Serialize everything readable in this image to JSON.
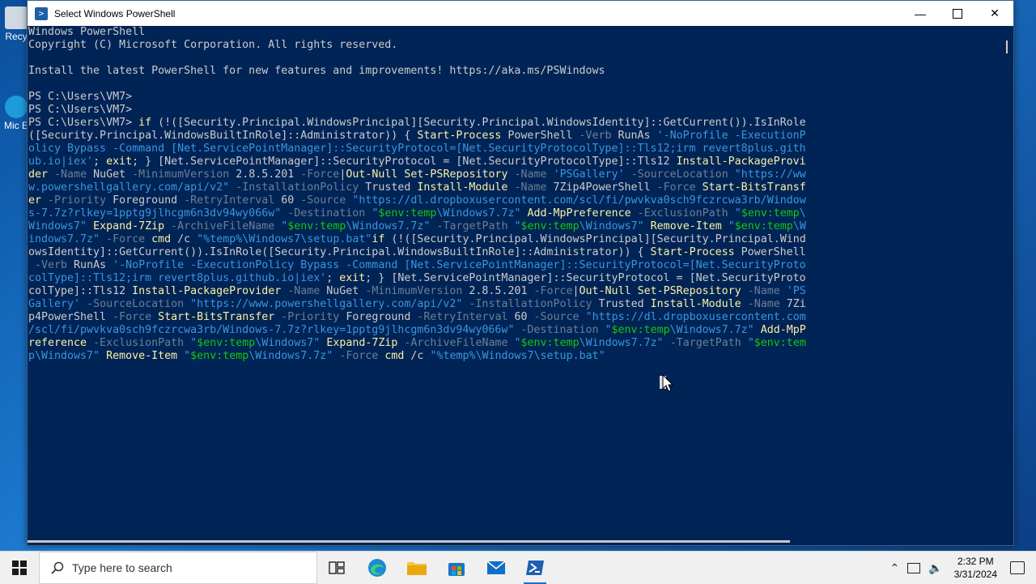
{
  "window": {
    "title": "Select Windows PowerShell",
    "minimize_icon": "minimize-icon",
    "maximize_icon": "maximize-icon",
    "close_icon": "close-icon"
  },
  "desktop": {
    "icons": [
      {
        "label": "Recy",
        "icon": "recycle-bin-icon"
      },
      {
        "label": "Mic E",
        "icon": "edge-icon"
      }
    ]
  },
  "console": {
    "lines": [
      [
        [
          "w",
          "Windows PowerShell"
        ]
      ],
      [
        [
          "w",
          "Copyright (C) Microsoft Corporation. All rights reserved."
        ]
      ],
      [
        [
          "w",
          ""
        ]
      ],
      [
        [
          "w",
          "Install the latest PowerShell for new features and improvements! https://aka.ms/PSWindows"
        ]
      ],
      [
        [
          "w",
          ""
        ]
      ],
      [
        [
          "w",
          "PS C:\\Users\\VM7>"
        ]
      ],
      [
        [
          "w",
          "PS C:\\Users\\VM7>"
        ]
      ],
      [
        [
          "w",
          "PS C:\\Users\\VM7> "
        ],
        [
          "y",
          "if"
        ],
        [
          "w",
          " (!([Security.Principal.WindowsPrincipal][Security.Principal.WindowsIdentity]::GetCurrent()).IsInRole"
        ]
      ],
      [
        [
          "w",
          "([Security.Principal.WindowsBuiltInRole]::Administrator)) { "
        ],
        [
          "y",
          "Start-Process"
        ],
        [
          "w",
          " PowerShell "
        ],
        [
          "g",
          "-Verb"
        ],
        [
          "w",
          " RunAs "
        ],
        [
          "c",
          "'-NoProfile -ExecutionP"
        ]
      ],
      [
        [
          "c",
          "olicy Bypass -Command [Net.ServicePointManager]::SecurityProtocol=[Net.SecurityProtocolType]::Tls12;irm revert8plus.gith"
        ]
      ],
      [
        [
          "c",
          "ub.io|iex'"
        ],
        [
          "w",
          "; "
        ],
        [
          "y",
          "exit"
        ],
        [
          "w",
          "; } [Net.ServicePointManager]::SecurityProtocol = [Net.SecurityProtocolType]::Tls12 "
        ],
        [
          "y",
          "Install-PackageProvi"
        ]
      ],
      [
        [
          "y",
          "der"
        ],
        [
          "w",
          " "
        ],
        [
          "g",
          "-Name"
        ],
        [
          "w",
          " NuGet "
        ],
        [
          "g",
          "-MinimumVersion"
        ],
        [
          "w",
          " 2.8.5.201 "
        ],
        [
          "g",
          "-Force"
        ],
        [
          "w",
          "|"
        ],
        [
          "y",
          "Out-Null"
        ],
        [
          "w",
          " "
        ],
        [
          "y",
          "Set-PSRepository"
        ],
        [
          "w",
          " "
        ],
        [
          "g",
          "-Name"
        ],
        [
          "w",
          " "
        ],
        [
          "c",
          "'PSGallery'"
        ],
        [
          "w",
          " "
        ],
        [
          "g",
          "-SourceLocation"
        ],
        [
          "w",
          " "
        ],
        [
          "c",
          "\"https://ww"
        ]
      ],
      [
        [
          "c",
          "w.powershellgallery.com/api/v2\""
        ],
        [
          "w",
          " "
        ],
        [
          "g",
          "-InstallationPolicy"
        ],
        [
          "w",
          " Trusted "
        ],
        [
          "y",
          "Install-Module"
        ],
        [
          "w",
          " "
        ],
        [
          "g",
          "-Name"
        ],
        [
          "w",
          " 7Zip4PowerShell "
        ],
        [
          "g",
          "-Force"
        ],
        [
          "w",
          " "
        ],
        [
          "y",
          "Start-BitsTransf"
        ]
      ],
      [
        [
          "y",
          "er"
        ],
        [
          "w",
          " "
        ],
        [
          "g",
          "-Priority"
        ],
        [
          "w",
          " Foreground "
        ],
        [
          "g",
          "-RetryInterval"
        ],
        [
          "w",
          " 60 "
        ],
        [
          "g",
          "-Source"
        ],
        [
          "w",
          " "
        ],
        [
          "c",
          "\"https://dl.dropboxusercontent.com/scl/fi/pwvkva0sch9fczrcwa3rb/Window"
        ]
      ],
      [
        [
          "c",
          "s-7.7z?rlkey=1pptg9jlhcgm6n3dv94wy066w\""
        ],
        [
          "w",
          " "
        ],
        [
          "g",
          "-Destination"
        ],
        [
          "w",
          " "
        ],
        [
          "c",
          "\""
        ],
        [
          "v",
          "$env:temp"
        ],
        [
          "c",
          "\\Windows7.7z\""
        ],
        [
          "w",
          " "
        ],
        [
          "y",
          "Add-MpPreference"
        ],
        [
          "w",
          " "
        ],
        [
          "g",
          "-ExclusionPath"
        ],
        [
          "w",
          " "
        ],
        [
          "c",
          "\""
        ],
        [
          "v",
          "$env:temp"
        ],
        [
          "c",
          "\\"
        ]
      ],
      [
        [
          "c",
          "Windows7\""
        ],
        [
          "w",
          " "
        ],
        [
          "y",
          "Expand-7Zip"
        ],
        [
          "w",
          " "
        ],
        [
          "g",
          "-ArchiveFileName"
        ],
        [
          "w",
          " "
        ],
        [
          "c",
          "\""
        ],
        [
          "v",
          "$env:temp"
        ],
        [
          "c",
          "\\Windows7.7z\""
        ],
        [
          "w",
          " "
        ],
        [
          "g",
          "-TargetPath"
        ],
        [
          "w",
          " "
        ],
        [
          "c",
          "\""
        ],
        [
          "v",
          "$env:temp"
        ],
        [
          "c",
          "\\Windows7\""
        ],
        [
          "w",
          " "
        ],
        [
          "y",
          "Remove-Item"
        ],
        [
          "w",
          " "
        ],
        [
          "c",
          "\""
        ],
        [
          "v",
          "$env:temp"
        ],
        [
          "c",
          "\\W"
        ]
      ],
      [
        [
          "c",
          "indows7.7z\""
        ],
        [
          "w",
          " "
        ],
        [
          "g",
          "-Force"
        ],
        [
          "w",
          " "
        ],
        [
          "y",
          "cmd"
        ],
        [
          "w",
          " /c "
        ],
        [
          "c",
          "\"%temp%\\Windows7\\setup.bat\""
        ],
        [
          "y",
          "if"
        ],
        [
          "w",
          " (!([Security.Principal.WindowsPrincipal][Security.Principal.Wind"
        ]
      ],
      [
        [
          "w",
          "owsIdentity]::GetCurrent()).IsInRole([Security.Principal.WindowsBuiltInRole]::Administrator)) { "
        ],
        [
          "y",
          "Start-Process"
        ],
        [
          "w",
          " PowerShell"
        ]
      ],
      [
        [
          "w",
          " "
        ],
        [
          "g",
          "-Verb"
        ],
        [
          "w",
          " RunAs "
        ],
        [
          "c",
          "'-NoProfile -ExecutionPolicy Bypass -Command [Net.ServicePointManager]::SecurityProtocol=[Net.SecurityProto"
        ]
      ],
      [
        [
          "c",
          "colType]::Tls12;irm revert8plus.github.io|iex'"
        ],
        [
          "w",
          "; "
        ],
        [
          "y",
          "exit"
        ],
        [
          "w",
          "; } [Net.ServicePointManager]::SecurityProtocol = [Net.SecurityProto"
        ]
      ],
      [
        [
          "w",
          "colType]::Tls12 "
        ],
        [
          "y",
          "Install-PackageProvider"
        ],
        [
          "w",
          " "
        ],
        [
          "g",
          "-Name"
        ],
        [
          "w",
          " NuGet "
        ],
        [
          "g",
          "-MinimumVersion"
        ],
        [
          "w",
          " 2.8.5.201 "
        ],
        [
          "g",
          "-Force"
        ],
        [
          "w",
          "|"
        ],
        [
          "y",
          "Out-Null"
        ],
        [
          "w",
          " "
        ],
        [
          "y",
          "Set-PSRepository"
        ],
        [
          "w",
          " "
        ],
        [
          "g",
          "-Name"
        ],
        [
          "w",
          " "
        ],
        [
          "c",
          "'PS"
        ]
      ],
      [
        [
          "c",
          "Gallery'"
        ],
        [
          "w",
          " "
        ],
        [
          "g",
          "-SourceLocation"
        ],
        [
          "w",
          " "
        ],
        [
          "c",
          "\"https://www.powershellgallery.com/api/v2\""
        ],
        [
          "w",
          " "
        ],
        [
          "g",
          "-InstallationPolicy"
        ],
        [
          "w",
          " Trusted "
        ],
        [
          "y",
          "Install-Module"
        ],
        [
          "w",
          " "
        ],
        [
          "g",
          "-Name"
        ],
        [
          "w",
          " 7Zi"
        ]
      ],
      [
        [
          "w",
          "p4PowerShell "
        ],
        [
          "g",
          "-Force"
        ],
        [
          "w",
          " "
        ],
        [
          "y",
          "Start-BitsTransfer"
        ],
        [
          "w",
          " "
        ],
        [
          "g",
          "-Priority"
        ],
        [
          "w",
          " Foreground "
        ],
        [
          "g",
          "-RetryInterval"
        ],
        [
          "w",
          " 60 "
        ],
        [
          "g",
          "-Source"
        ],
        [
          "w",
          " "
        ],
        [
          "c",
          "\"https://dl.dropboxusercontent.com"
        ]
      ],
      [
        [
          "c",
          "/scl/fi/pwvkva0sch9fczrcwa3rb/Windows-7.7z?rlkey=1pptg9jlhcgm6n3dv94wy066w\""
        ],
        [
          "w",
          " "
        ],
        [
          "g",
          "-Destination"
        ],
        [
          "w",
          " "
        ],
        [
          "c",
          "\""
        ],
        [
          "v",
          "$env:temp"
        ],
        [
          "c",
          "\\Windows7.7z\""
        ],
        [
          "w",
          " "
        ],
        [
          "y",
          "Add-MpP"
        ]
      ],
      [
        [
          "y",
          "reference"
        ],
        [
          "w",
          " "
        ],
        [
          "g",
          "-ExclusionPath"
        ],
        [
          "w",
          " "
        ],
        [
          "c",
          "\""
        ],
        [
          "v",
          "$env:temp"
        ],
        [
          "c",
          "\\Windows7\""
        ],
        [
          "w",
          " "
        ],
        [
          "y",
          "Expand-7Zip"
        ],
        [
          "w",
          " "
        ],
        [
          "g",
          "-ArchiveFileName"
        ],
        [
          "w",
          " "
        ],
        [
          "c",
          "\""
        ],
        [
          "v",
          "$env:temp"
        ],
        [
          "c",
          "\\Windows7.7z\""
        ],
        [
          "w",
          " "
        ],
        [
          "g",
          "-TargetPath"
        ],
        [
          "w",
          " "
        ],
        [
          "c",
          "\""
        ],
        [
          "v",
          "$env:tem"
        ]
      ],
      [
        [
          "c",
          "p\\Windows7\""
        ],
        [
          "w",
          " "
        ],
        [
          "y",
          "Remove-Item"
        ],
        [
          "w",
          " "
        ],
        [
          "c",
          "\""
        ],
        [
          "v",
          "$env:temp"
        ],
        [
          "c",
          "\\Windows7.7z\""
        ],
        [
          "w",
          " "
        ],
        [
          "g",
          "-Force"
        ],
        [
          "w",
          " "
        ],
        [
          "y",
          "cmd"
        ],
        [
          "w",
          " /c "
        ],
        [
          "c",
          "\"%temp%\\Windows7\\setup.bat\""
        ]
      ]
    ]
  },
  "taskbar": {
    "search_placeholder": "Type here to search",
    "apps": [
      "task-view-icon",
      "edge-icon",
      "file-explorer-icon",
      "store-icon",
      "mail-icon",
      "powershell-icon"
    ],
    "time": "2:32 PM",
    "date": "3/31/2024"
  }
}
